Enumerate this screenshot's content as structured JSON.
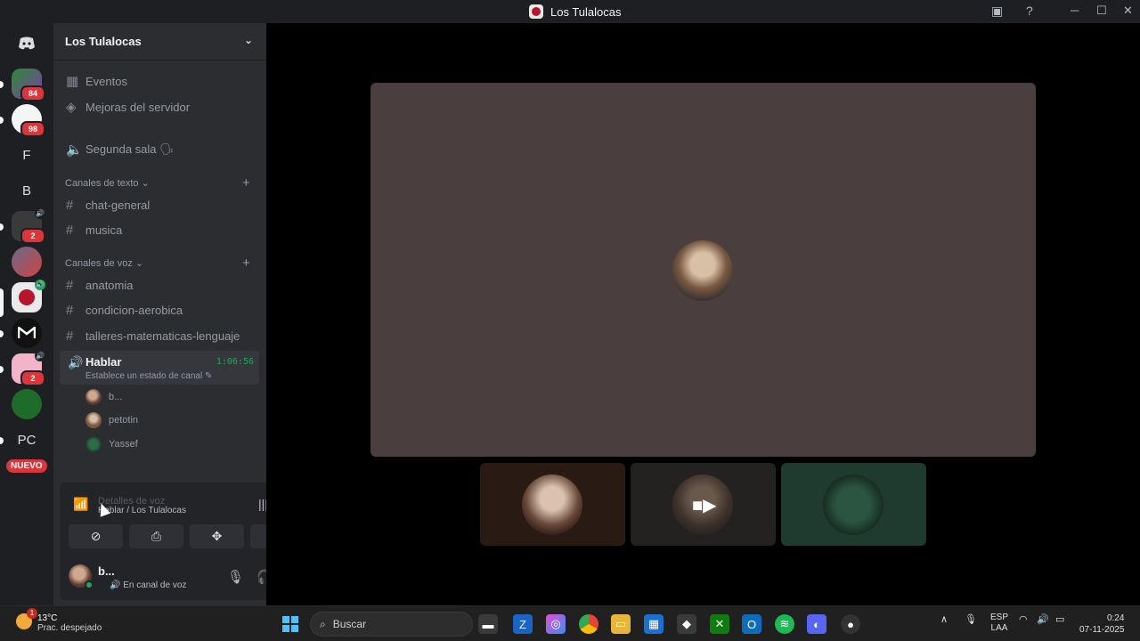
{
  "window": {
    "title": "Los Tulalocas"
  },
  "servers": {
    "badges": [
      "84",
      "98",
      "2",
      "2"
    ],
    "letters": [
      "F",
      "B",
      "PC"
    ],
    "new_label": "NUEVO"
  },
  "sidebar": {
    "server_name": "Los Tulalocas",
    "top_items": [
      "Eventos",
      "Mejoras del servidor"
    ],
    "lobby": "Segunda sala 🗣",
    "text_category": "Canales de texto",
    "text_channels": [
      "chat-general",
      "musica"
    ],
    "voice_category": "Canales de voz",
    "voice_channels": [
      "anatomia",
      "condicion-aerobica",
      "talleres-matematicas-lenguaje"
    ],
    "active_voice": {
      "name": "Hablar",
      "elapsed": "1:06:56",
      "status_prompt": "Establece un estado de canal"
    },
    "members": [
      "b...",
      "petotin",
      "Yassef"
    ]
  },
  "voice_panel": {
    "connection_text": "Detalles de voz",
    "location": "Hablar / Los Tulalocas"
  },
  "user": {
    "name": "b...",
    "status": "En canal de voz"
  },
  "taskbar": {
    "weather_temp": "13°C",
    "weather_desc": "Prac. despejado",
    "weather_badge": "1",
    "search_placeholder": "Buscar",
    "lang_top": "ESP",
    "lang_bottom": "LAA",
    "time": "0:24",
    "date": "07-11-2025"
  },
  "colors": {
    "accent_green": "#23a55a",
    "badge_red": "#da373c",
    "sidebar_bg": "#2b2d31",
    "rail_bg": "#1e1f22"
  }
}
